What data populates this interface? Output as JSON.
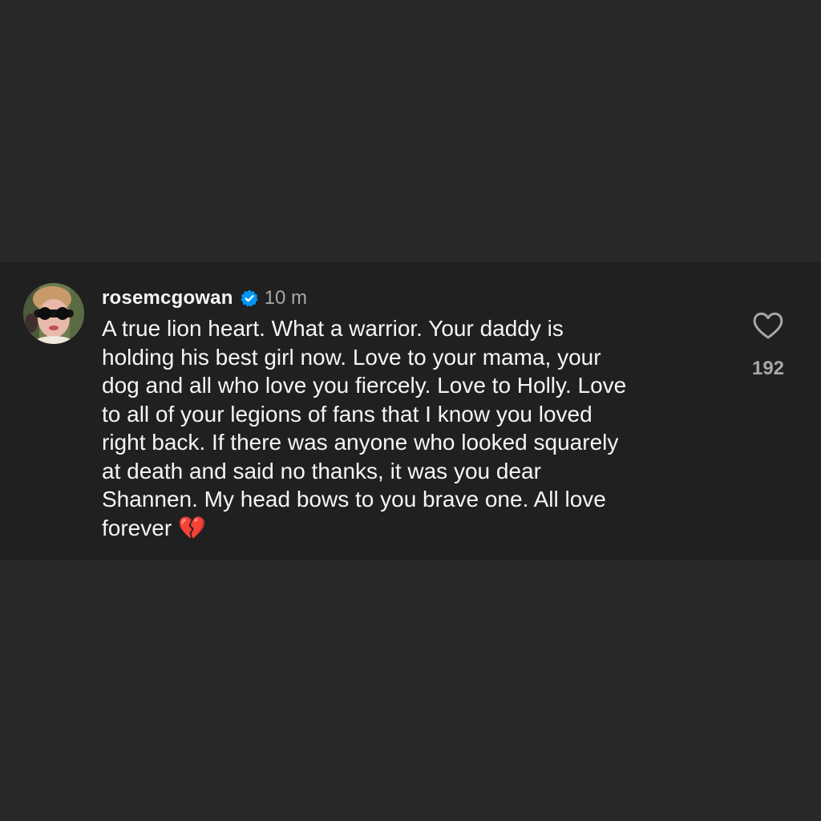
{
  "comment": {
    "username": "rosemcgowan",
    "verified_icon": "verified-badge-icon",
    "timestamp": "10 m",
    "text": "A true lion heart. What a warrior. Your daddy is\nholding his best girl now. Love to your mama, your\ndog and all who love you fiercely. Love to Holly. Love\nto all of your legions of fans that I know you loved\nright back. If there was anyone who looked squarely\nat death and said no thanks, it was you dear\nShannen. My head bows to you brave one. All love\nforever ",
    "emoji": "💔",
    "like_icon": "heart-outline-icon",
    "like_count": "192"
  },
  "colors": {
    "page_background": "#282828",
    "card_background": "#202020",
    "text_primary": "#f5f5f5",
    "text_secondary": "#a8a8a8",
    "verified_blue": "#0095f6"
  }
}
